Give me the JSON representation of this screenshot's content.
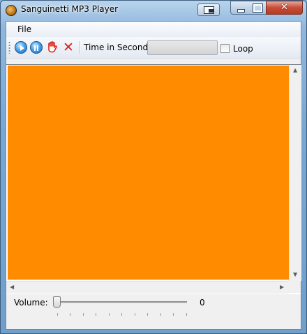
{
  "window": {
    "title": "Sanguinetti MP3 Player",
    "close_glyph": "✕",
    "minimize_glyph": "",
    "maximize_glyph": ""
  },
  "menu": {
    "file_label": "File"
  },
  "toolbar": {
    "time_label": "Time in Seconds",
    "time_value": "",
    "loop_label": "Loop",
    "loop_checked": false,
    "stop_glyph": "✕"
  },
  "video": {
    "background_color": "#ff8c00"
  },
  "volume": {
    "label": "Volume:",
    "value": "0",
    "level": 0
  },
  "icons": {
    "app": "mp3-player-icon",
    "play": "play-icon",
    "pause": "pause-icon",
    "stop": "stop-hand-icon",
    "close": "close-x-icon"
  }
}
